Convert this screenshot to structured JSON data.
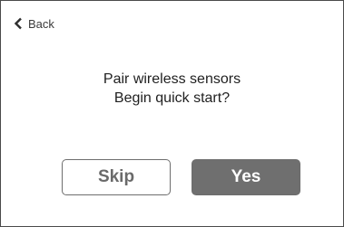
{
  "nav": {
    "back_label": "Back",
    "back_icon": "chevron-left-icon"
  },
  "prompt": {
    "line1": "Pair wireless sensors",
    "line2": "Begin quick start?"
  },
  "actions": {
    "skip_label": "Skip",
    "yes_label": "Yes"
  },
  "colors": {
    "frame_border": "#4a4a4a",
    "primary_button_bg": "#6f6f6f",
    "secondary_button_border": "#6e6e6e",
    "secondary_button_text": "#6a6a6a"
  }
}
